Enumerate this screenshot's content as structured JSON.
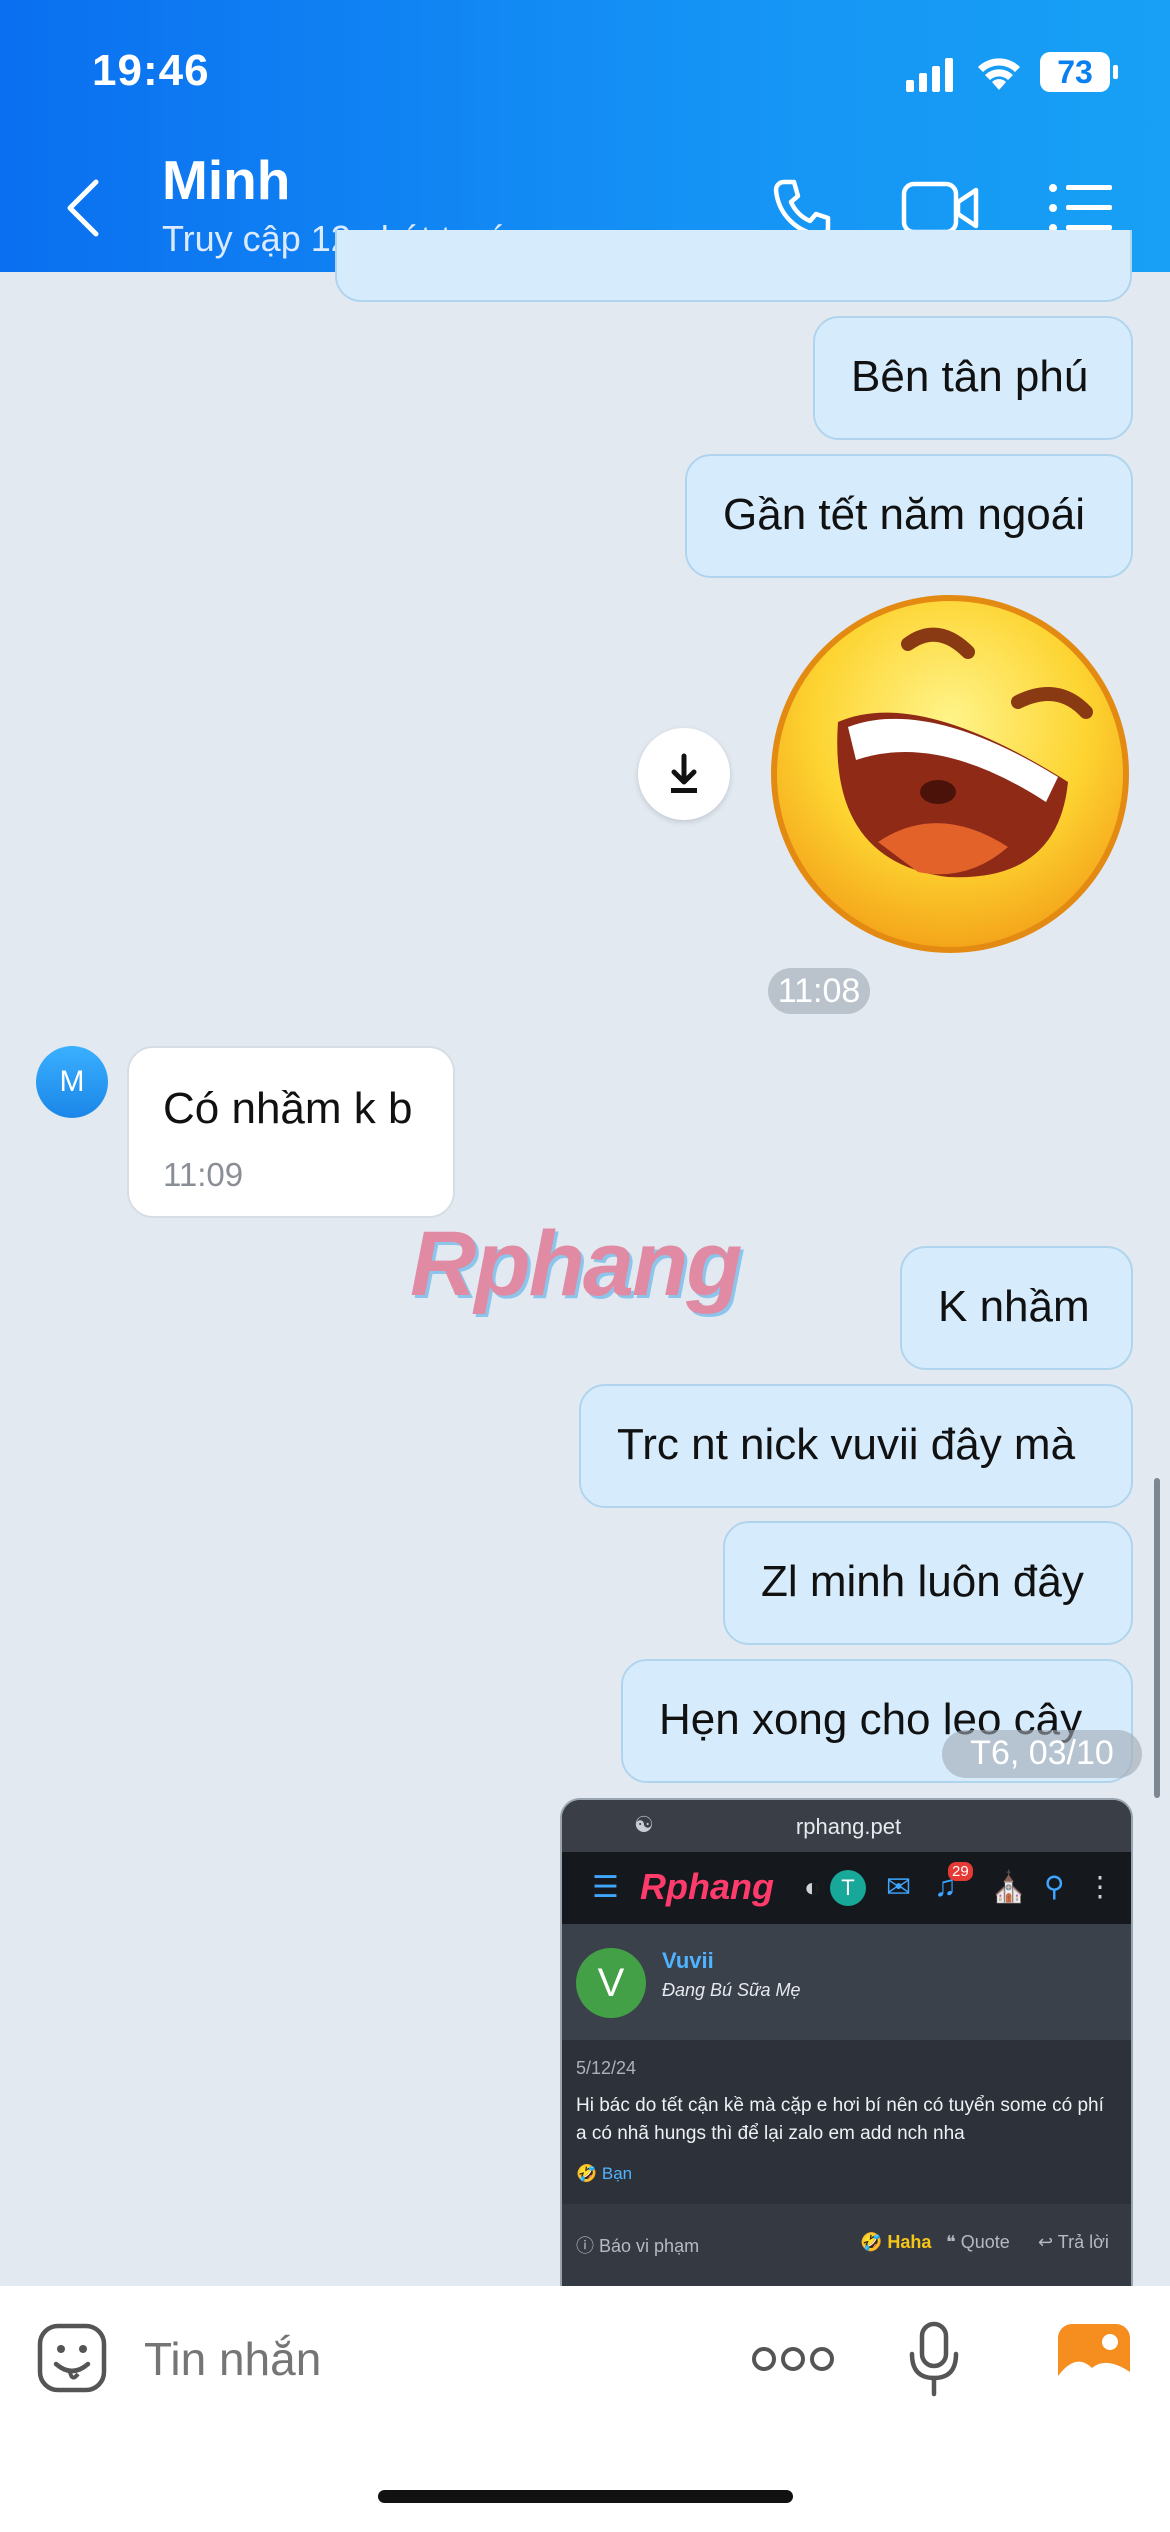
{
  "status_bar": {
    "time": "19:46",
    "battery": "73"
  },
  "header": {
    "name": "Minh",
    "status": "Truy cập 12 phút trước"
  },
  "messages": {
    "m1": "Bên tân phú",
    "m2": "Gần tết năm ngoái",
    "sticker_time": "11:08",
    "avatar_letter": "M",
    "incoming_text": "Có nhầm k b",
    "incoming_time": "11:09",
    "m3": "K nhầm",
    "m4": "Trc nt nick vuvii đây mà",
    "m5": "Zl minh luôn đây",
    "m6": "Hẹn xong cho leo cây",
    "date_pill": "T6, 03/10"
  },
  "watermark": "Rphang",
  "screenshot": {
    "url": "rphang.pet",
    "logo": "Rphang",
    "avatar_letter": "T",
    "notif_count": "29",
    "user_initial": "V",
    "username": "Vuvii",
    "user_title": "Đang Bú Sữa Mẹ",
    "date": "5/12/24",
    "post_text": "Hi bác do tết cận kề mà cặp e hơi bí nên có tuyển some có phí a có nhã hungs thì để lại zalo em add nch nha",
    "reaction": "Bạn",
    "report": "Báo vi phạm",
    "haha": "Haha",
    "quote": "Quote",
    "reply": "Trả lời"
  },
  "input": {
    "placeholder": "Tin nhắn"
  },
  "colors": {
    "header": "#0a7cf2",
    "bubble_out": "#d6ecfd",
    "chat_bg": "#e2e9f1"
  }
}
